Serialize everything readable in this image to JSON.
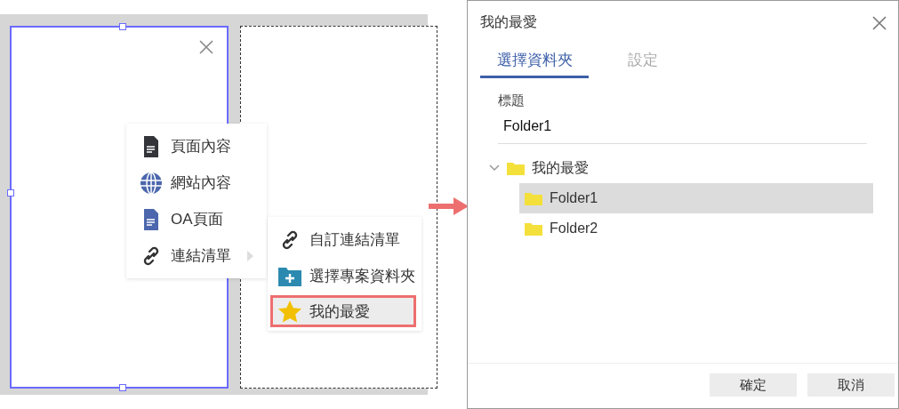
{
  "editor": {
    "menu": {
      "items": [
        {
          "label": "頁面內容",
          "kind": "page",
          "submenu": false
        },
        {
          "label": "網站內容",
          "kind": "globe",
          "submenu": false
        },
        {
          "label": "OA頁面",
          "kind": "oa",
          "submenu": false
        },
        {
          "label": "連結清單",
          "kind": "link",
          "submenu": true
        }
      ]
    },
    "submenu": {
      "items": [
        {
          "label": "自訂連結清單",
          "kind": "link",
          "selected": false
        },
        {
          "label": "選擇專案資料夾",
          "kind": "folder-add",
          "selected": false
        },
        {
          "label": "我的最愛",
          "kind": "star",
          "selected": true
        }
      ]
    }
  },
  "dialog": {
    "title": "我的最愛",
    "tabs": [
      {
        "label": "選擇資料夾",
        "selected": true
      },
      {
        "label": "設定",
        "selected": false
      }
    ],
    "title_field": {
      "label": "標題",
      "value": "Folder1"
    },
    "tree": [
      {
        "label": "我的最愛",
        "expanded": true,
        "selected": false,
        "children": [
          {
            "label": "Folder1",
            "selected": true
          },
          {
            "label": "Folder2",
            "selected": false
          }
        ]
      }
    ],
    "buttons": [
      "確定",
      "取消"
    ]
  }
}
